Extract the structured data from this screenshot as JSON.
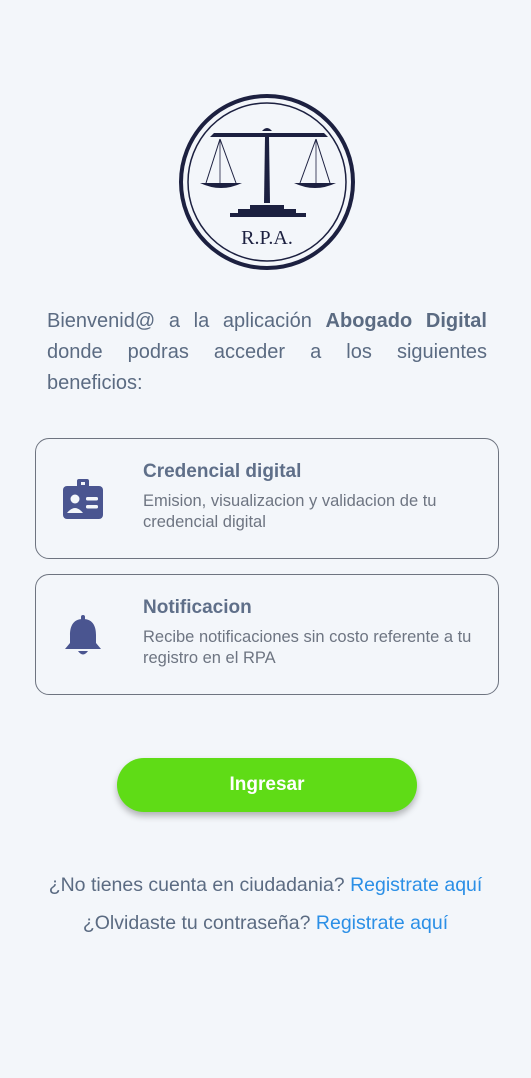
{
  "logo": {
    "text": "R.P.A."
  },
  "intro": {
    "prefix": "Bienvenid@ a la aplicación ",
    "app_name": "Abogado Digital",
    "suffix": " donde podras acceder a los siguientes beneficios:"
  },
  "benefits": [
    {
      "title": "Credencial digital",
      "description": "Emision, visualizacion y validacion de tu credencial digital",
      "icon": "badge-icon"
    },
    {
      "title": "Notificacion",
      "description": "Recibe notificaciones sin costo referente a tu registro en el RPA",
      "icon": "bell-icon"
    }
  ],
  "login_button": {
    "label": "Ingresar"
  },
  "footer": {
    "no_account_text": "¿No tienes cuenta en ciudadania? ",
    "no_account_link": "Registrate aquí",
    "forgot_text": "¿Olvidaste tu contraseña? ",
    "forgot_link": "Registrate aquí"
  },
  "colors": {
    "background": "#f3f6fa",
    "primary_text": "#5b6b82",
    "icon": "#4a5590",
    "button": "#5fdc16",
    "link": "#2b8fe6",
    "logo": "#1c2040"
  }
}
